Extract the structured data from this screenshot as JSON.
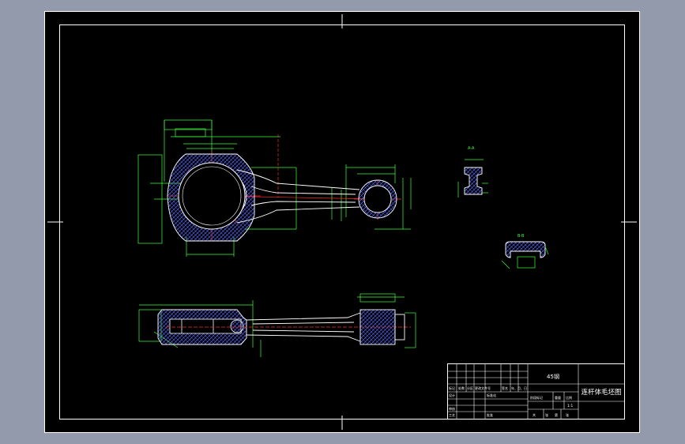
{
  "drawing": {
    "title_block": {
      "top_label": "45钢",
      "drawing_name": "连杆体毛坯图",
      "header_cells": [
        "标记",
        "处数",
        "分区",
        "更改文件号",
        "签名",
        "年、月、日"
      ],
      "role_labels": [
        "设计",
        "审核",
        "工艺"
      ],
      "mid_label": "标准化",
      "stage_labels": [
        "阶段标记",
        "重量",
        "比例"
      ],
      "scale": "1:1",
      "bottom_labels": [
        "共",
        "张",
        "第",
        "张"
      ],
      "approve_label": "批准"
    },
    "section_labels": [
      "A-A",
      "B-B"
    ]
  },
  "colors": {
    "sheet": "#000000",
    "outside": "#929aab",
    "line": "#ffffff",
    "dimension": "#3cff3c",
    "centerline": "#ff2a2a",
    "hatch": "#5a6aff"
  }
}
